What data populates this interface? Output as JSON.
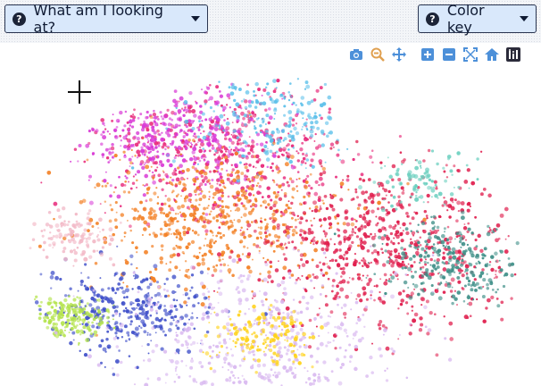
{
  "header": {
    "what_button": {
      "label": "What am I looking at?",
      "icon": "question-circle-icon"
    },
    "color_button": {
      "label": "Color key",
      "icon": "question-circle-icon"
    }
  },
  "modebar": {
    "icon_color": "#4d90d9",
    "active_color": "#e0a050",
    "buttons": [
      {
        "name": "camera-icon",
        "action": "download-plot"
      },
      {
        "name": "zoom-icon",
        "action": "zoom",
        "active": true
      },
      {
        "name": "pan-icon",
        "action": "pan"
      },
      {
        "name": "zoom-in-icon",
        "action": "zoom-in"
      },
      {
        "name": "zoom-out-icon",
        "action": "zoom-out"
      },
      {
        "name": "autoscale-icon",
        "action": "autoscale"
      },
      {
        "name": "home-icon",
        "action": "reset-axes"
      },
      {
        "name": "plotly-logo-icon",
        "action": "logo"
      }
    ]
  },
  "chart_data": {
    "type": "scatter",
    "title": "",
    "xlabel": "",
    "ylabel": "",
    "grid": false,
    "legend": "none",
    "clusters": [
      {
        "color": "#e8297a",
        "x": 0.4,
        "y": 0.22,
        "spread": 0.13,
        "n": 520
      },
      {
        "color": "#d93bd6",
        "x": 0.28,
        "y": 0.18,
        "spread": 0.1,
        "n": 380
      },
      {
        "color": "#5cc0ea",
        "x": 0.52,
        "y": 0.12,
        "spread": 0.09,
        "n": 220
      },
      {
        "color": "#f37f23",
        "x": 0.38,
        "y": 0.45,
        "spread": 0.12,
        "n": 600
      },
      {
        "color": "#e01e4d",
        "x": 0.72,
        "y": 0.55,
        "spread": 0.14,
        "n": 780
      },
      {
        "color": "#3f8f88",
        "x": 0.86,
        "y": 0.6,
        "spread": 0.07,
        "n": 260
      },
      {
        "color": "#3f4fc9",
        "x": 0.2,
        "y": 0.76,
        "spread": 0.08,
        "n": 360
      },
      {
        "color": "#b3e34a",
        "x": 0.08,
        "y": 0.78,
        "spread": 0.04,
        "n": 180
      },
      {
        "color": "#d9b9f0",
        "x": 0.48,
        "y": 0.88,
        "spread": 0.15,
        "n": 480
      },
      {
        "color": "#ffd21a",
        "x": 0.48,
        "y": 0.84,
        "spread": 0.05,
        "n": 150
      },
      {
        "color": "#f2b8c6",
        "x": 0.1,
        "y": 0.52,
        "spread": 0.04,
        "n": 120
      },
      {
        "color": "#6dd0c0",
        "x": 0.8,
        "y": 0.34,
        "spread": 0.05,
        "n": 90
      }
    ]
  }
}
